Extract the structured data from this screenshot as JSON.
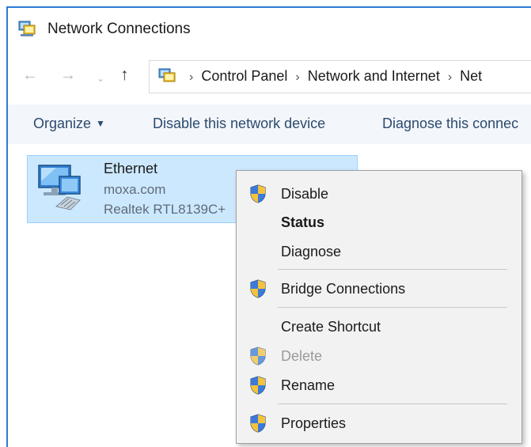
{
  "window": {
    "title": "Network Connections"
  },
  "nav": {
    "back_icon": "arrow-left-icon",
    "forward_icon": "arrow-right-icon",
    "recent_icon": "chevron-down-icon",
    "up_icon": "arrow-up-icon",
    "breadcrumb": [
      "Control Panel",
      "Network and Internet",
      "Net"
    ]
  },
  "toolbar": {
    "organize_label": "Organize",
    "disable_label": "Disable this network device",
    "diagnose_label": "Diagnose this connec"
  },
  "connection": {
    "name": "Ethernet",
    "network": "moxa.com",
    "device": "Realtek RTL8139C+"
  },
  "context_menu": {
    "disable": "Disable",
    "status": "Status",
    "diagnose": "Diagnose",
    "bridge": "Bridge Connections",
    "shortcut": "Create Shortcut",
    "delete": "Delete",
    "rename": "Rename",
    "properties": "Properties"
  },
  "colors": {
    "accent": "#2b7bd6",
    "selection": "#cce8ff",
    "menu_bg": "#f2f2f2",
    "command_text": "#2c4a6e"
  }
}
